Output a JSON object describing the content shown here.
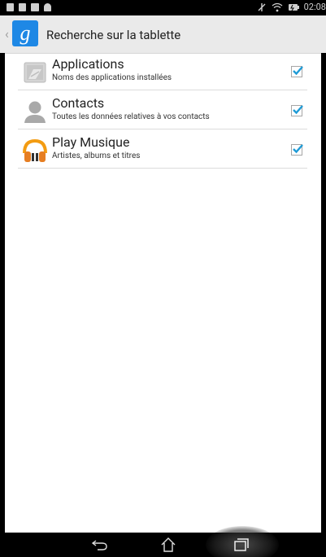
{
  "status_bar": {
    "left_icons": [
      "notification-icon",
      "document-icon",
      "image-icon",
      "android-icon"
    ],
    "right_icons": [
      "airplane-mode-off-icon",
      "wifi-icon",
      "battery-icon"
    ],
    "time": "02:08"
  },
  "action_bar": {
    "title": "Recherche sur la tablette",
    "logo_letter": "g"
  },
  "items": [
    {
      "title": "Applications",
      "subtitle": "Noms des applications installées",
      "icon": "applications-icon",
      "checked": true
    },
    {
      "title": "Contacts",
      "subtitle": "Toutes les données relatives à vos contacts",
      "icon": "contacts-icon",
      "checked": true
    },
    {
      "title": "Play Musique",
      "subtitle": "Artistes, albums et titres",
      "icon": "play-music-icon",
      "checked": true
    }
  ],
  "nav_bar": {
    "buttons": [
      "back-icon",
      "home-icon",
      "recents-icon"
    ]
  },
  "colors": {
    "accent_blue": "#1e88e5",
    "checkmark": "#1f9bd6",
    "actionbar_bg": "#eaeaea"
  }
}
